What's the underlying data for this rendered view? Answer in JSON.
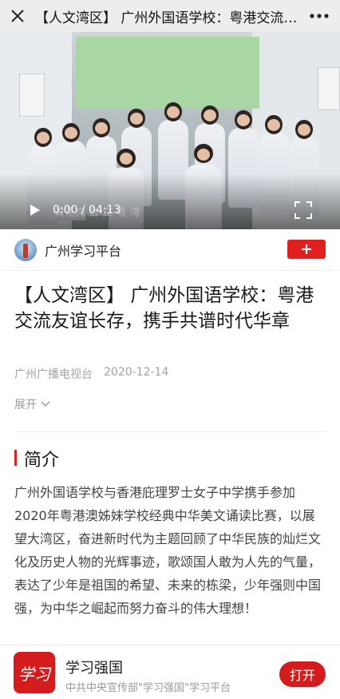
{
  "topbar": {
    "title": "【人文湾区】 广州外国语学校：粤港交流友谊长存，携手共谱时代华章",
    "close_icon": "close-icon",
    "more_icon": "more-icon"
  },
  "video": {
    "current_time": "0:00",
    "duration": "04:13",
    "time_display": "0:00 / 04:13",
    "watermark": "黄花岗 台 文 粤 湾",
    "progress": 0
  },
  "channel": {
    "name": "广州学习平台",
    "follow_label": "+"
  },
  "article": {
    "headline": "【人文湾区】 广州外国语学校：粤港交流友谊长存，携手共谱时代华章",
    "source": "广州广播电视台",
    "date": "2020-12-14",
    "expand_label": "展开"
  },
  "intro": {
    "section_title": "简介",
    "body": "广州外国语学校与香港庇理罗士女子中学携手参加2020年粤港澳姊妹学校经典中华美文诵读比赛，以展望大湾区，奋进新时代为主题回顾了中华民族的灿烂文化及历史人物的光辉事迹，歌颂国人敢为人先的气量，表达了少年是祖国的希望、未来的栋梁，少年强则中国强，为中华之崛起而努力奋斗的伟大理想！"
  },
  "app_banner": {
    "logo_text": "学习",
    "app_name": "学习强国",
    "description": "中共中央宣传部\"学习强国\"学习平台",
    "open_label": "打开"
  },
  "colors": {
    "accent": "#e02020",
    "topbar_bg": "#ededed"
  }
}
